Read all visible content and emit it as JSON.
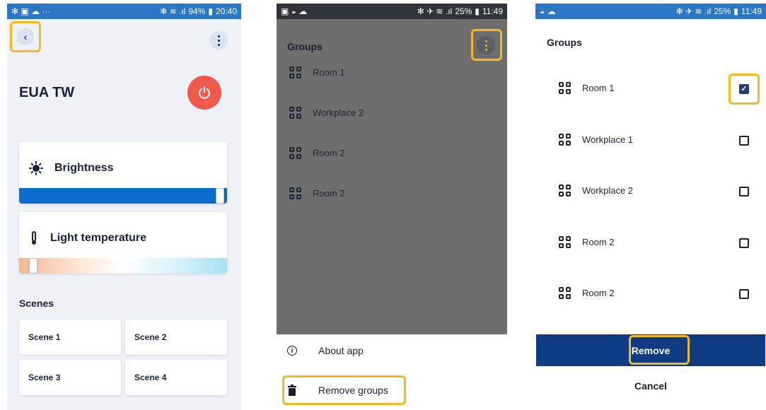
{
  "screen1": {
    "status_time": "20:40",
    "status_battery": "94%",
    "status_left": "✻ ▣ ☁ ···",
    "device_title": "EUA TW",
    "brightness_label": "Brightness",
    "brightness_level": 1.0,
    "temperature_label": "Light temperature",
    "temperature_level": 0.05,
    "scenes_header": "Scenes",
    "scenes": [
      "Scene 1",
      "Scene 2",
      "Scene 3",
      "Scene 4"
    ],
    "colors": {
      "statusbar": "#2b77c4",
      "power": "#f0594c",
      "brightness_track": "#0a6ccd",
      "highlight": "#f5b91d"
    }
  },
  "screen2": {
    "status_time": "11:49",
    "status_battery": "25%",
    "title": "Groups",
    "groups": [
      "Room 1",
      "Workplace 2",
      "Room 2",
      "Room 2"
    ],
    "menu": {
      "about": "About app",
      "remove": "Remove groups"
    },
    "colors": {
      "overlay": "#6e6e6e",
      "statusbar": "#30343a"
    }
  },
  "screen3": {
    "status_time": "11:49",
    "status_battery": "25%",
    "title": "Groups",
    "groups": [
      {
        "label": "Room 1",
        "checked": true
      },
      {
        "label": "Workplace 1",
        "checked": false
      },
      {
        "label": "Workplace 2",
        "checked": false
      },
      {
        "label": "Room 2",
        "checked": false
      },
      {
        "label": "Room 2",
        "checked": false
      }
    ],
    "remove_label": "Remove",
    "cancel_label": "Cancel",
    "colors": {
      "remove_bar": "#0f3b83",
      "checkbox_on": "#1f3d7a"
    }
  }
}
